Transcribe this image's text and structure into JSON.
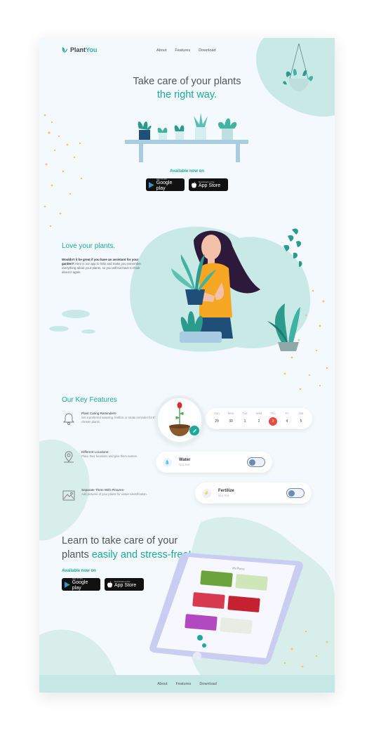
{
  "brand": {
    "name_part1": "Plant",
    "name_part2": "You"
  },
  "nav": {
    "about": "About",
    "features": "Features",
    "download": "Download"
  },
  "hero": {
    "title_line1": "Take care of your plants",
    "title_line2": "the right way.",
    "available": "Available now on"
  },
  "stores": {
    "google_small": "GET IT ON",
    "google_big": "Google play",
    "apple_small": "Download on the",
    "apple_big": "App Store"
  },
  "love": {
    "title": "Love your plants.",
    "body_bold": "Wouldn't it be great if you have an assistant for your garden?",
    "body_rest": " Here is our app to help and make you remember everything about your plants, so you will not have to think about it again."
  },
  "features": {
    "title": "Our Key Features",
    "items": [
      {
        "title": "Plant Caring Reminders-",
        "desc": "Set a preferred watering, fertilize or rotate reminder for the chosen plants."
      },
      {
        "title": "Different Locations-",
        "desc": "Place their locations and give them names."
      },
      {
        "title": "Separate Them With Pictures-",
        "desc": "Add pictures of your plants for easier identification."
      }
    ]
  },
  "calendar": {
    "days": [
      {
        "name": "Sun",
        "date": "29"
      },
      {
        "name": "Mon",
        "date": "30"
      },
      {
        "name": "Tue",
        "date": "1"
      },
      {
        "name": "Wed",
        "date": "2"
      },
      {
        "name": "Thu",
        "date": "3"
      },
      {
        "name": "Fri",
        "date": "4"
      },
      {
        "name": "Sat",
        "date": "5"
      }
    ],
    "active_index": 4
  },
  "toggles": {
    "water": {
      "label": "Water",
      "status": "Not Set"
    },
    "fertilize": {
      "label": "Fertilize",
      "status": "Not Set"
    }
  },
  "learn": {
    "title_line1": "Learn to take care of your",
    "title_plain": "plants ",
    "title_accent": "easily and stress-free!",
    "available": "Available now on"
  },
  "phone": {
    "screen_title": "My Plants"
  },
  "footer": {
    "about": "About",
    "features": "Features",
    "download": "Download"
  },
  "colors": {
    "accent": "#1aa99c",
    "blob": "#c8e9e6",
    "active_day": "#e84a3c",
    "dots": "#f2c46b"
  }
}
